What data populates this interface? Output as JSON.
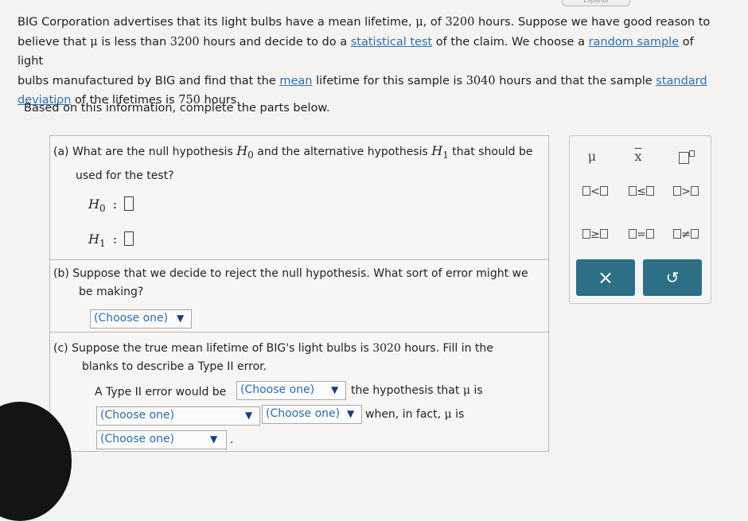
{
  "header": {
    "stub": "Español"
  },
  "problem": {
    "s1": "BIG Corporation advertises that its light bulbs have a mean lifetime, ",
    "mu": "μ",
    "s2": ", of ",
    "v1": "3200",
    "s3": " hours. Suppose we have good reason to",
    "s4": "believe that ",
    "s5": " is less than ",
    "v2": "3200",
    "s6": " hours and decide to do a ",
    "link1": "statistical test",
    "s7": " of the claim. We choose a ",
    "link2": "random sample",
    "s8": " of light",
    "s9": "bulbs manufactured by BIG and find that the ",
    "link3": "mean",
    "s10": " lifetime for this sample is ",
    "v3": "3040",
    "s11": " hours and that the sample ",
    "link4": "standard",
    "link5": "deviation",
    "s12": " of the lifetimes is ",
    "v4": "750",
    "s13": " hours.",
    "info": "Based on this information, complete the parts below."
  },
  "part_a": {
    "q1": "(a)  What are the null hypothesis ",
    "q2": " and the alternative hypothesis ",
    "q3": " that should be",
    "q4": "used for the test?",
    "H": "H",
    "s0": "0",
    "s1": "1",
    "colon": ":"
  },
  "part_b": {
    "q1": "(b)  Suppose that we decide to reject the null hypothesis. What sort of error might we",
    "q2": "be making?",
    "dropdown": "(Choose one)"
  },
  "part_c": {
    "q1": "(c)  Suppose the true mean lifetime of BIG's light bulbs is ",
    "val": "3020",
    "q2": " hours. Fill in the",
    "q3": "blanks to describe a Type II error.",
    "t1": "A Type II error would be",
    "t2": "the hypothesis that ",
    "t3": " is",
    "t4": "when, in fact, ",
    "t5": " is",
    "t6": ".",
    "dropdown": "(Choose one)",
    "mu": "μ"
  },
  "palette": {
    "mu": "μ",
    "xbar": "x",
    "lt": "<",
    "le": "≤",
    "gt": ">",
    "ge": "≥",
    "eq": "=",
    "ne": "≠",
    "clear": "×",
    "undo": "↺"
  },
  "colors": {
    "link": "#2e6faa",
    "button": "#2c6f86",
    "dropdown_text": "#2f6cab"
  },
  "icons": {
    "arrow": "▼"
  }
}
